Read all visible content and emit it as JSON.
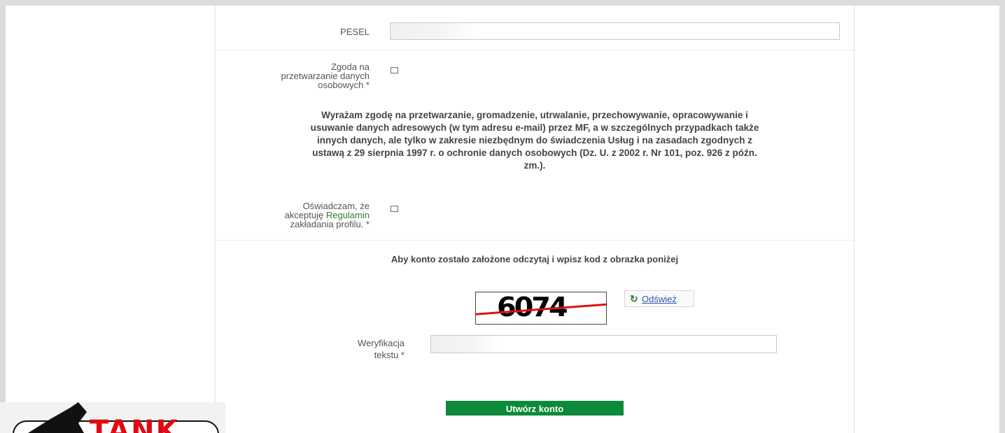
{
  "form": {
    "pesel": {
      "label": "PESEL",
      "value": ""
    },
    "consent_processing": {
      "label_lines": [
        "Zgoda na",
        "przetwarzanie danych",
        "osobowych *"
      ],
      "checked": false
    },
    "consent_text_lines": [
      "Wyrażam zgodę na przetwarzanie, gromadzenie, utrwalanie, przechowywanie, opracowywanie i",
      "usuwanie danych adresowych (w tym adresu e-mail) przez MF, a w szczególnych przypadkach także",
      "innych danych, ale tylko w zakresie niezbędnym do świadczenia Usług i na zasadach zgodnych z",
      "ustawą z 29 sierpnia 1997 r. o ochronie danych osobowych (Dz. U. z 2002 r. Nr 101, poz. 926 z późn.",
      "zm.)."
    ],
    "terms": {
      "line1": "Oświadczam, że",
      "line2_prefix": "akceptuję ",
      "link": "Regulamin",
      "line3": "zakładania profilu. *",
      "checked": false
    },
    "captcha": {
      "instruction": "Aby konto zostało założone odczytaj i wpisz kod z obrazka poniżej",
      "image_text": "6074",
      "refresh_label": "Odśwież",
      "refresh_icon": "refresh-icon"
    },
    "verification": {
      "label_lines": [
        "Weryfikacja",
        "tekstu *"
      ],
      "value": ""
    },
    "submit_label": "Utwórz konto"
  },
  "logo": {
    "text": "TANK"
  },
  "colors": {
    "accent": "#0c8a3a",
    "link": "#2e7d32",
    "captcha_line": "#dd1111"
  }
}
